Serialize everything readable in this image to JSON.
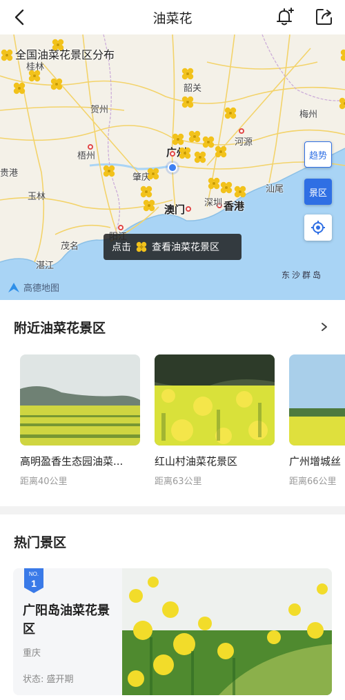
{
  "header": {
    "title": "油菜花"
  },
  "map": {
    "title": "全国油菜花景区分布",
    "cities": [
      "桂林",
      "韶关",
      "贺州",
      "梅州",
      "河源",
      "梧州",
      "广州",
      "肇庆",
      "贵港",
      "玉林",
      "汕尾",
      "澳门",
      "深圳",
      "香港",
      "阳江",
      "茂名",
      "湛江"
    ],
    "buttons": {
      "trend": "趋势",
      "spots": "景区"
    },
    "tip": {
      "prefix": "点击",
      "suffix": "查看油菜花景区"
    },
    "attribution": "高德地图",
    "islands": "东沙群岛"
  },
  "nearby": {
    "title": "附近油菜花景区",
    "items": [
      {
        "name": "高明盈香生态园油菜...",
        "distance": "距离40公里"
      },
      {
        "name": "红山村油菜花景区",
        "distance": "距离63公里"
      },
      {
        "name": "广州增城丝",
        "distance": "距离66公里"
      }
    ]
  },
  "hot": {
    "title": "热门景区",
    "items": [
      {
        "rank_label": "NO.",
        "rank": "1",
        "name": "广阳岛油菜花景区",
        "city": "重庆",
        "status": "状态: 盛开期"
      }
    ]
  },
  "colors": {
    "accent": "#2f6fe4",
    "flower": "#f2c21b",
    "sea": "#a9d4f5",
    "land": "#f4f1e8"
  }
}
